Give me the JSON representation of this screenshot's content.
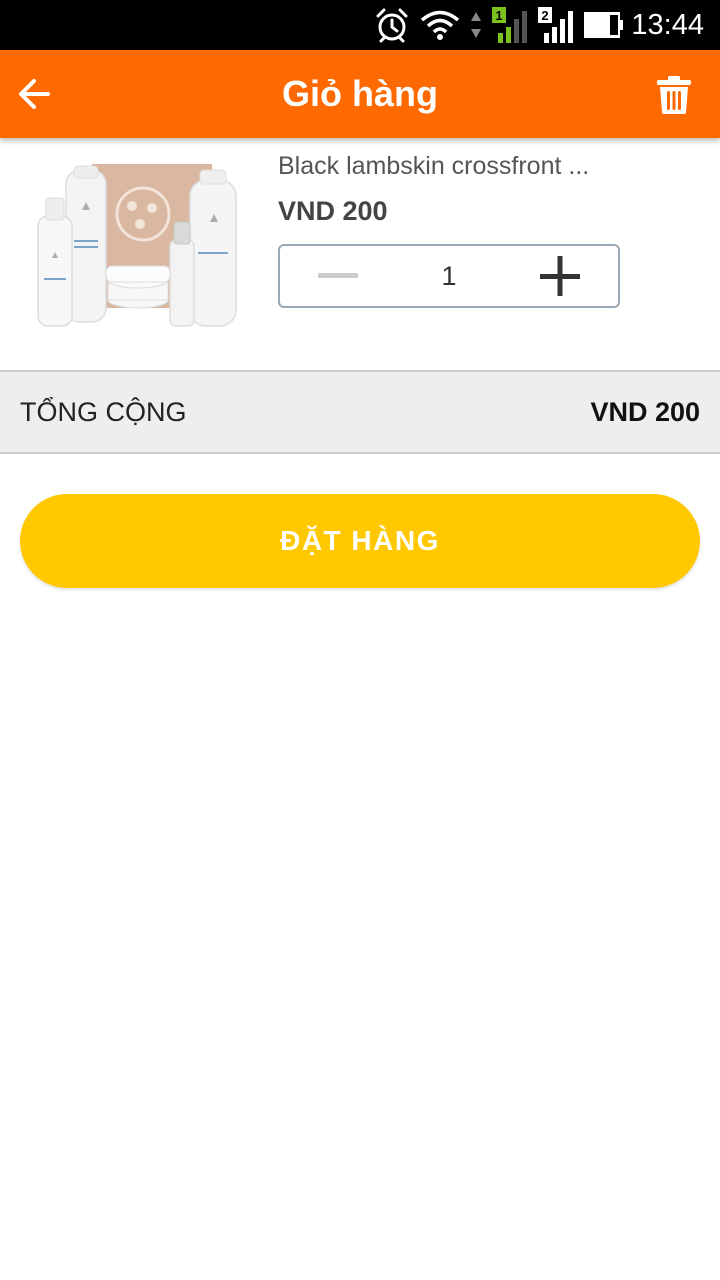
{
  "status_bar": {
    "time": "13:44",
    "sim1_label": "1",
    "sim2_label": "2",
    "icons": [
      "alarm-icon",
      "wifi-icon",
      "data-arrows-icon",
      "signal-sim1-icon",
      "signal-sim2-icon",
      "battery-icon"
    ]
  },
  "app_bar": {
    "title": "Giỏ hàng",
    "back_icon": "arrow-left-icon",
    "delete_icon": "trash-icon",
    "background_color": "#ff6a00"
  },
  "cart": {
    "items": [
      {
        "name": "Black lambskin crossfront ...",
        "price": "VND 200",
        "quantity": "1",
        "image": "product-photo"
      }
    ]
  },
  "total": {
    "label": "TỔNG CỘNG",
    "value": "VND 200"
  },
  "order_button": {
    "label": "ĐẶT HÀNG",
    "color": "#ffc800"
  }
}
